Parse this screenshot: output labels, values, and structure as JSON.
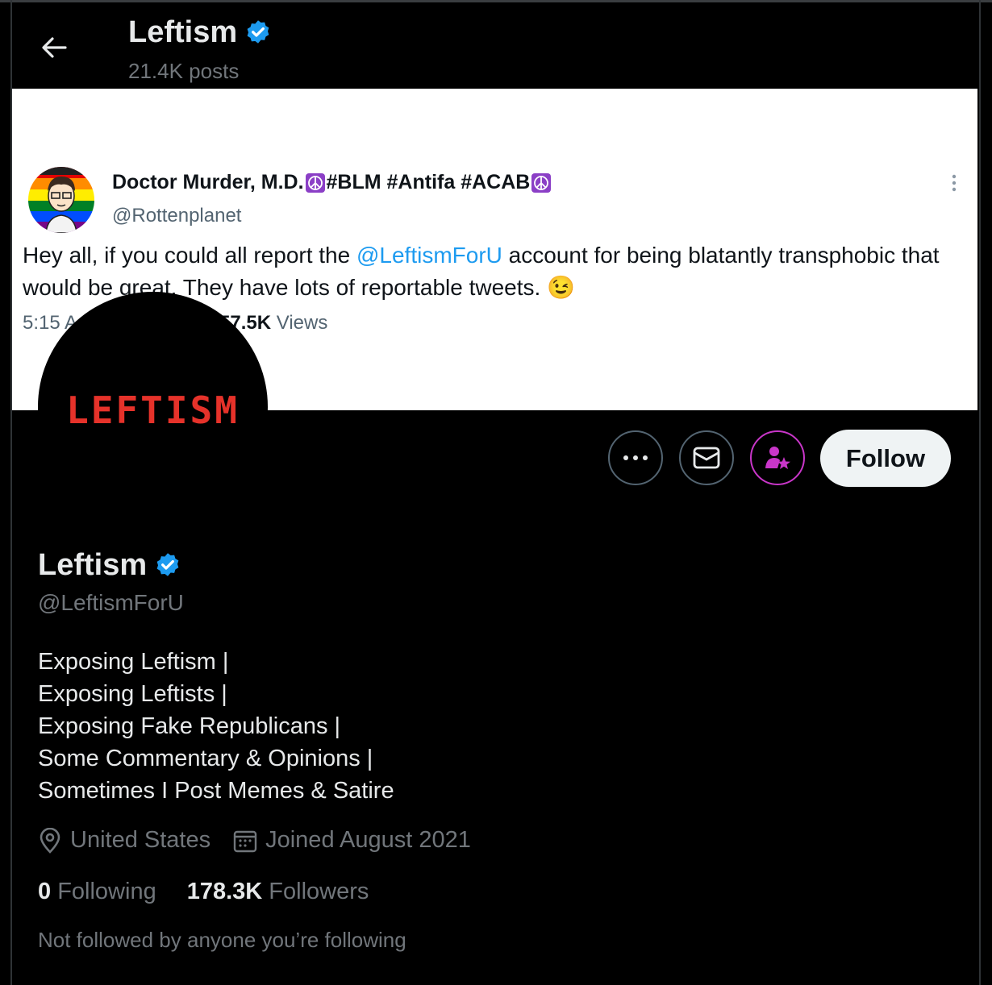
{
  "header": {
    "title": "Leftism",
    "posts_count": "21.4K posts"
  },
  "banner_tweet": {
    "author_name": "Doctor Murder, M.D.",
    "author_name_tags": "#BLM #Antifa #ACAB",
    "author_handle": "@Rottenplanet",
    "text_before": "Hey all, if you could all report the ",
    "text_mention": "@LeftismForU",
    "text_after": " account for being blatantly transphobic that would be great. They have lots of reportable tweets. 😉",
    "time_partial": "5:15 A",
    "views_count": "57.5K",
    "views_label": " Views"
  },
  "avatar": {
    "logo_text": "LEFTISM"
  },
  "actions": {
    "follow_label": "Follow"
  },
  "profile": {
    "name": "Leftism",
    "handle": "@LeftismForU",
    "bio": [
      "Exposing Leftism |",
      "Exposing Leftists |",
      "Exposing Fake Republicans |",
      "Some Commentary & Opinions |",
      "Sometimes I Post Memes & Satire"
    ],
    "location": "United States",
    "joined": "Joined August 2021",
    "following_count": "0",
    "following_label": "Following",
    "followers_count": "178.3K",
    "followers_label": "Followers",
    "not_followed_note": "Not followed by anyone you’re following"
  },
  "colors": {
    "accent": "#1d9bf0",
    "verified": "#1d9bf0",
    "subscribe": "#c936c9",
    "logo_red": "#e6322a"
  },
  "icons": [
    "back-arrow-icon",
    "verified-badge-icon",
    "peace-icon",
    "more-dots-icon",
    "message-icon",
    "subscribe-icon",
    "location-icon",
    "calendar-icon"
  ]
}
